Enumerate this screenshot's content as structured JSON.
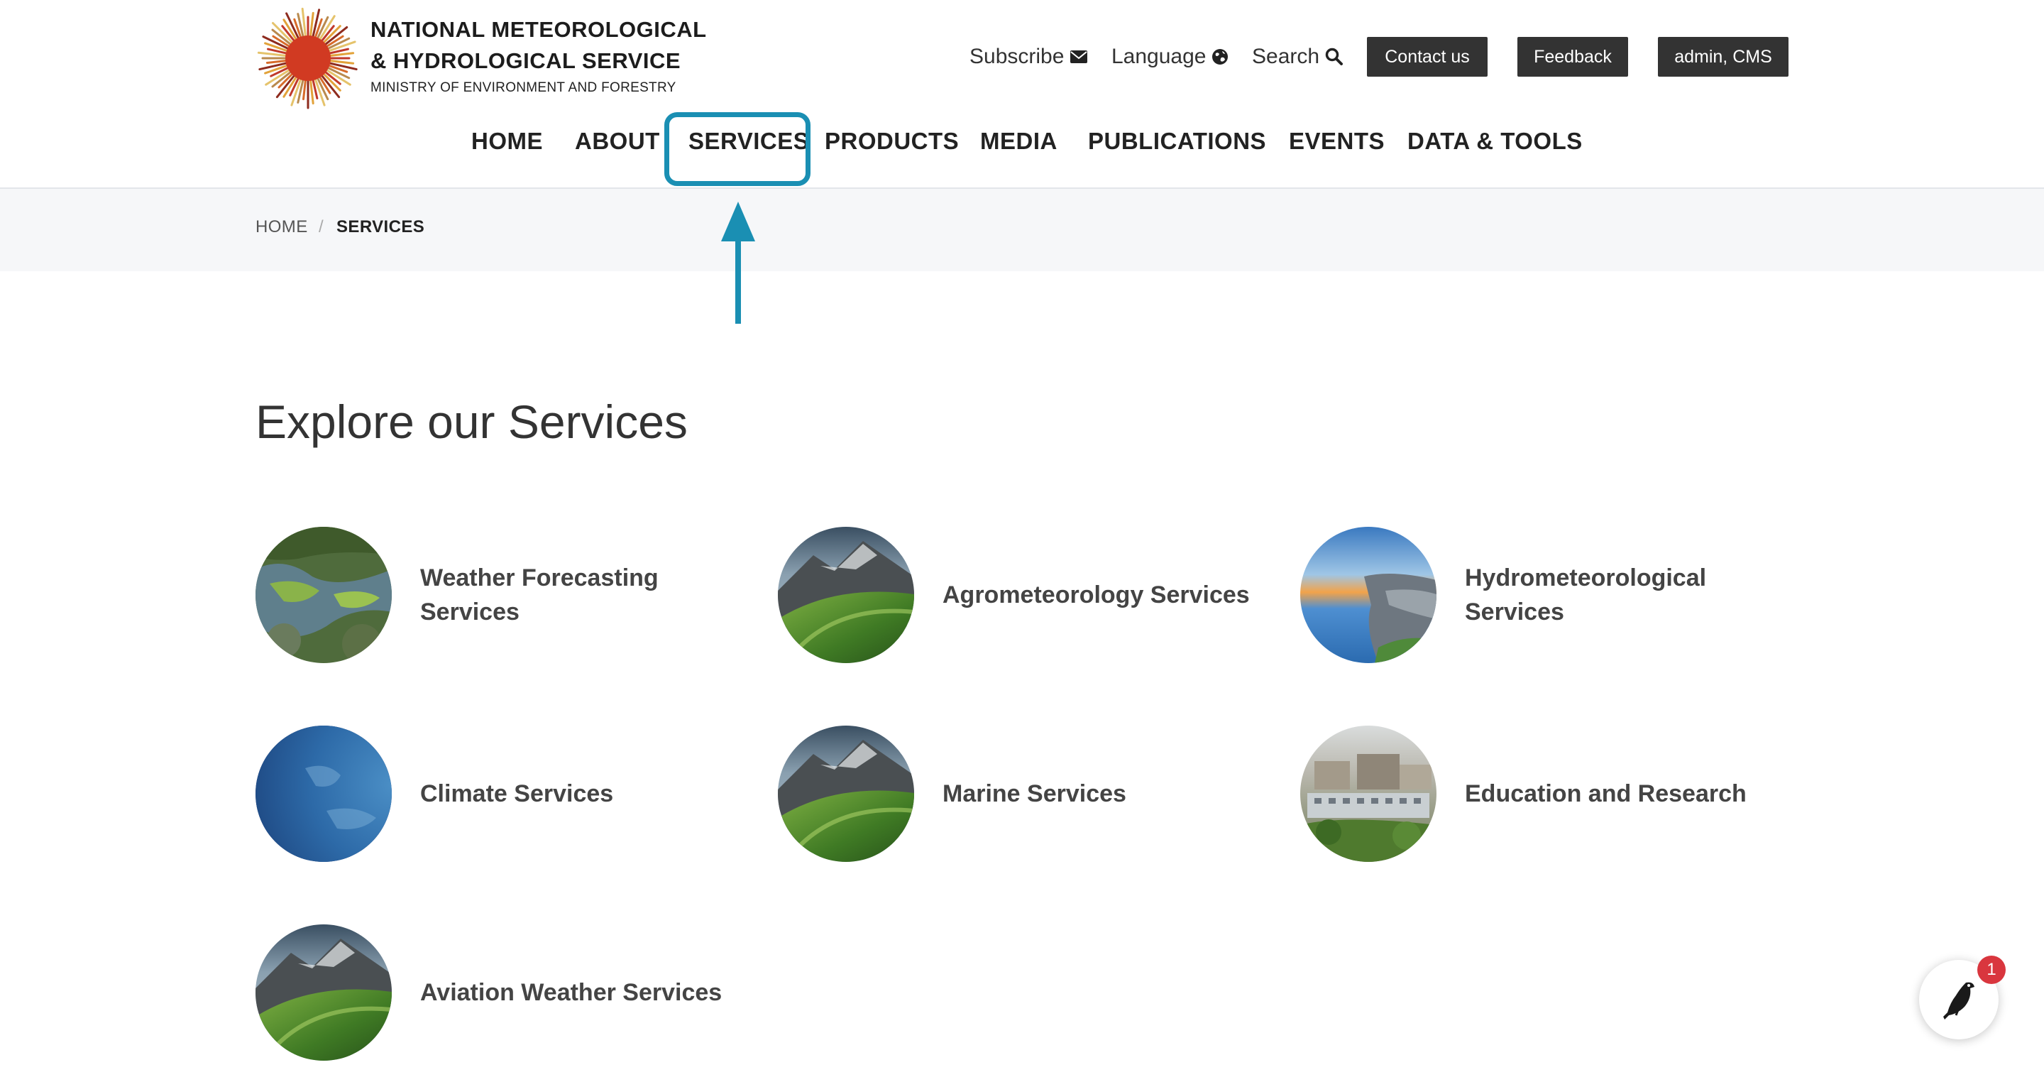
{
  "header": {
    "org_name_line1": "NATIONAL METEOROLOGICAL",
    "org_name_line2": "& HYDROLOGICAL SERVICE",
    "org_subtitle": "MINISTRY OF ENVIRONMENT AND FORESTRY",
    "utility": {
      "subscribe": "Subscribe",
      "subscribe_icon": "envelope-icon",
      "language": "Language",
      "language_icon": "globe-icon",
      "search": "Search",
      "search_icon": "search-icon",
      "contact": "Contact us",
      "feedback": "Feedback",
      "admin": "admin, CMS"
    },
    "nav": [
      "HOME",
      "ABOUT",
      "SERVICES",
      "PRODUCTS",
      "MEDIA",
      "PUBLICATIONS",
      "EVENTS",
      "DATA & TOOLS"
    ],
    "active_nav": "SERVICES"
  },
  "breadcrumb": {
    "home": "HOME",
    "separator": "/",
    "current": "SERVICES"
  },
  "main": {
    "title": "Explore our Services",
    "services": [
      {
        "label_line1": "Weather Forecasting",
        "label_line2": "Services",
        "image": "aerial-wetland"
      },
      {
        "label_line1": "Agrometeorology Services",
        "label_line2": "",
        "image": "mountain-slope"
      },
      {
        "label_line1": "Hydrometeorological",
        "label_line2": "Services",
        "image": "coast-sunset"
      },
      {
        "label_line1": "Climate Services",
        "label_line2": "",
        "image": "earth-ocean"
      },
      {
        "label_line1": "Marine Services",
        "label_line2": "",
        "image": "mountain-slope"
      },
      {
        "label_line1": "Education and Research",
        "label_line2": "",
        "image": "campus-buildings"
      },
      {
        "label_line1": "Aviation Weather Services",
        "label_line2": "",
        "image": "mountain-slope"
      }
    ]
  },
  "chat_widget": {
    "icon": "bird-icon",
    "badge_count": "1"
  },
  "colors": {
    "highlight": "#1a8fb3",
    "dark_button": "#333333",
    "badge": "#d9363e",
    "breadcrumb_bg": "#f6f7f9"
  }
}
